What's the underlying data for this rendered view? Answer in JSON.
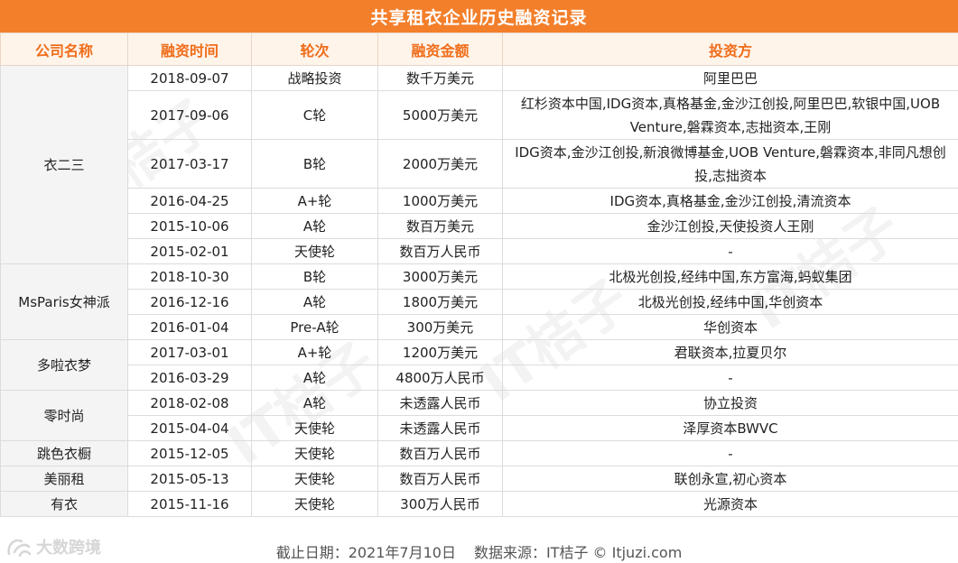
{
  "title": "共享租衣企业历史融资记录",
  "headers": [
    "公司名称",
    "融资时间",
    "轮次",
    "融资金额",
    "投资方"
  ],
  "groups": [
    {
      "company": "衣二三",
      "rows": [
        {
          "date": "2018-09-07",
          "round": "战略投资",
          "amount": "数千万美元",
          "investors": "阿里巴巴",
          "lines": 1
        },
        {
          "date": "2017-09-06",
          "round": "C轮",
          "amount": "5000万美元",
          "investors": "红杉资本中国,IDG资本,真格基金,金沙江创投,阿里巴巴,软银中国,UOB Venture,磐霖资本,志拙资本,王刚",
          "lines": 2
        },
        {
          "date": "2017-03-17",
          "round": "B轮",
          "amount": "2000万美元",
          "investors": "IDG资本,金沙江创投,新浪微博基金,UOB Venture,磐霖资本,非同凡想创投,志拙资本",
          "lines": 2
        },
        {
          "date": "2016-04-25",
          "round": "A+轮",
          "amount": "1000万美元",
          "investors": "IDG资本,真格基金,金沙江创投,清流资本",
          "lines": 1
        },
        {
          "date": "2015-10-06",
          "round": "A轮",
          "amount": "数百万美元",
          "investors": "金沙江创投,天使投资人王刚",
          "lines": 1
        },
        {
          "date": "2015-02-01",
          "round": "天使轮",
          "amount": "数百万人民币",
          "investors": "-",
          "lines": 1
        }
      ]
    },
    {
      "company": "MsParis女神派",
      "rows": [
        {
          "date": "2018-10-30",
          "round": "B轮",
          "amount": "3000万美元",
          "investors": "北极光创投,经纬中国,东方富海,蚂蚁集团",
          "lines": 1
        },
        {
          "date": "2016-12-16",
          "round": "A轮",
          "amount": "1800万美元",
          "investors": "北极光创投,经纬中国,华创资本",
          "lines": 1
        },
        {
          "date": "2016-01-04",
          "round": "Pre-A轮",
          "amount": "300万美元",
          "investors": "华创资本",
          "lines": 1
        }
      ]
    },
    {
      "company": "多啦衣梦",
      "rows": [
        {
          "date": "2017-03-01",
          "round": "A+轮",
          "amount": "1200万美元",
          "investors": "君联资本,拉夏贝尔",
          "lines": 1
        },
        {
          "date": "2016-03-29",
          "round": "A轮",
          "amount": "4800万人民币",
          "investors": "-",
          "lines": 1
        }
      ]
    },
    {
      "company": "零时尚",
      "rows": [
        {
          "date": "2018-02-08",
          "round": "A轮",
          "amount": "未透露人民币",
          "investors": "协立投资",
          "lines": 1
        },
        {
          "date": "2015-04-04",
          "round": "天使轮",
          "amount": "未透露人民币",
          "investors": "泽厚资本BWVC",
          "lines": 1
        }
      ]
    },
    {
      "company": "跳色衣橱",
      "rows": [
        {
          "date": "2015-12-05",
          "round": "天使轮",
          "amount": "数百万人民币",
          "investors": "-",
          "lines": 1
        }
      ]
    },
    {
      "company": "美丽租",
      "rows": [
        {
          "date": "2015-05-13",
          "round": "天使轮",
          "amount": "数百万人民币",
          "investors": "联创永宣,初心资本",
          "lines": 1
        }
      ]
    },
    {
      "company": "有衣",
      "rows": [
        {
          "date": "2015-11-16",
          "round": "天使轮",
          "amount": "300万人民币",
          "investors": "光源资本",
          "lines": 1
        }
      ]
    }
  ],
  "footer": {
    "cutoff": "截止日期：2021年7月10日",
    "source": "数据来源：IT桔子 © Itjuzi.com"
  },
  "logo_text": "大数跨境",
  "watermark_text": "IT桔子",
  "colors": {
    "title_bg": "#f37f2b",
    "header_bg": "#fff4ea",
    "header_text": "#ef6d1a"
  },
  "icons": [
    "logo-icon"
  ]
}
